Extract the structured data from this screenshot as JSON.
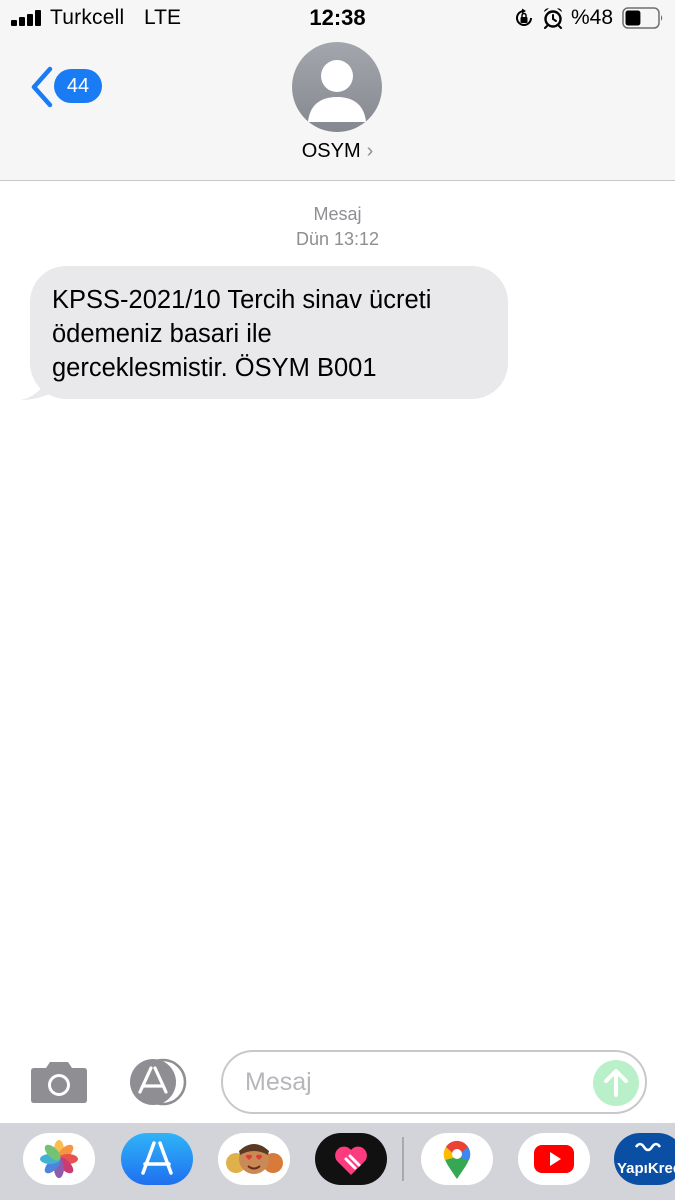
{
  "status_bar": {
    "carrier": "Turkcell",
    "network": "LTE",
    "time": "12:38",
    "battery_text": "%48",
    "battery_level": 0.48,
    "icons": [
      "signal-icon",
      "rotation-lock-icon",
      "alarm-icon",
      "battery-icon"
    ]
  },
  "header": {
    "back_badge": "44",
    "contact_name": "OSYM",
    "contact_chevron": "›"
  },
  "conversation": {
    "meta_kind": "Mesaj",
    "meta_time": "Dün 13:12",
    "messages": [
      {
        "direction": "incoming",
        "lines": [
          "KPSS-2021/10 Tercih sinav ücreti",
          "ödemeniz basari ile",
          "gerceklesmistir. ÖSYM B001"
        ]
      }
    ]
  },
  "compose": {
    "placeholder": "Mesaj",
    "value": ""
  },
  "app_drawer": {
    "apps": [
      "photos-icon",
      "app-store-icon",
      "memoji-icon",
      "digital-touch-icon",
      "google-maps-icon",
      "youtube-icon",
      "yapikredi-icon"
    ],
    "yapikredi_label": "YapıKredi"
  },
  "colors": {
    "accent": "#1a7cf5",
    "bubble_incoming": "#e9e9eb",
    "header_bg": "#f6f6f6",
    "meta_text": "#8e8e93",
    "send_button": "#b9f0c9",
    "drawer_bg": "#d3d4d9"
  }
}
